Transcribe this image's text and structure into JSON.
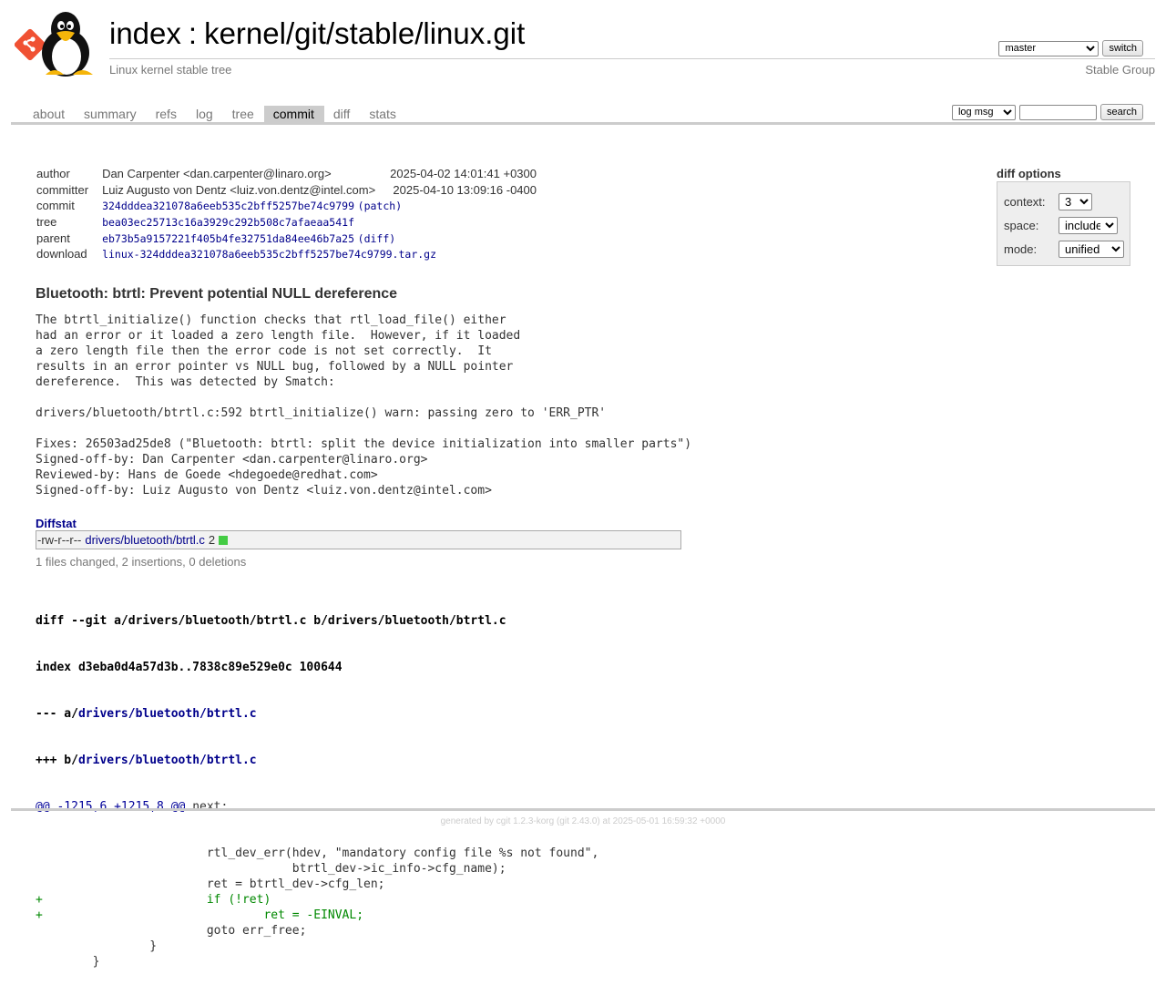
{
  "header": {
    "index_link": "index",
    "separator": ":",
    "repo_path": "kernel/git/stable/linux.git",
    "subtitle": "Linux kernel stable tree",
    "owner": "Stable Group",
    "branch_selected": "master",
    "switch_label": "switch"
  },
  "tabs": [
    {
      "label": "about"
    },
    {
      "label": "summary"
    },
    {
      "label": "refs"
    },
    {
      "label": "log"
    },
    {
      "label": "tree"
    },
    {
      "label": "commit",
      "active": true
    },
    {
      "label": "diff"
    },
    {
      "label": "stats"
    }
  ],
  "search": {
    "scope_selected": "log msg",
    "query": "",
    "button_label": "search"
  },
  "commit_info": {
    "author_label": "author",
    "author": "Dan Carpenter <dan.carpenter@linaro.org>",
    "author_date": "2025-04-02 14:01:41 +0300",
    "committer_label": "committer",
    "committer": "Luiz Augusto von Dentz <luiz.von.dentz@intel.com>",
    "committer_date": "2025-04-10 13:09:16 -0400",
    "commit_label": "commit",
    "commit_hash": "324dddea321078a6eeb535c2bff5257be74c9799",
    "patch_link": "patch",
    "tree_label": "tree",
    "tree_hash": "bea03ec25713c16a3929c292b508c7afaeaa541f",
    "parent_label": "parent",
    "parent_hash": "eb73b5a9157221f405b4fe32751da84ee46b7a25",
    "diff_link": "diff",
    "download_label": "download",
    "download_file": "linux-324dddea321078a6eeb535c2bff5257be74c9799.tar.gz"
  },
  "diff_options": {
    "title": "diff options",
    "context_label": "context:",
    "context_value": "3",
    "space_label": "space:",
    "space_value": "include",
    "mode_label": "mode:",
    "mode_value": "unified"
  },
  "subject": "Bluetooth: btrtl: Prevent potential NULL dereference",
  "message": "The btrtl_initialize() function checks that rtl_load_file() either\nhad an error or it loaded a zero length file.  However, if it loaded\na zero length file then the error code is not set correctly.  It\nresults in an error pointer vs NULL bug, followed by a NULL pointer\ndereference.  This was detected by Smatch:\n\ndrivers/bluetooth/btrtl.c:592 btrtl_initialize() warn: passing zero to 'ERR_PTR'\n\nFixes: 26503ad25de8 (\"Bluetooth: btrtl: split the device initialization into smaller parts\")\nSigned-off-by: Dan Carpenter <dan.carpenter@linaro.org>\nReviewed-by: Hans de Goede <hdegoede@redhat.com>\nSigned-off-by: Luiz Augusto von Dentz <luiz.von.dentz@intel.com>",
  "diffstat": {
    "header": "Diffstat",
    "mode": "-rw-r--r--",
    "file": "drivers/bluetooth/btrtl.c",
    "count": "2",
    "summary": "1 files changed, 2 insertions, 0 deletions"
  },
  "diff": {
    "git_line_prefix": "diff --git a/drivers/bluetooth/btrtl.c b/drivers/bluetooth/btrtl.c",
    "index_line": "index d3eba0d4a57d3b..7838c89e529e0c 100644",
    "minus_prefix": "--- a/",
    "minus_file": "drivers/bluetooth/btrtl.c",
    "plus_prefix": "+++ b/",
    "plus_file": "drivers/bluetooth/btrtl.c",
    "hunk_header": "@@ -1215,6 +1215,8 @@",
    "hunk_context": " next:",
    "lines": [
      {
        "type": "ctx",
        "text": " \t\t\trtl_dev_err(hdev, \"mandatory config file %s not found\","
      },
      {
        "type": "ctx",
        "text": " \t\t\t\t    btrtl_dev->ic_info->cfg_name);"
      },
      {
        "type": "ctx",
        "text": " \t\t\tret = btrtl_dev->cfg_len;"
      },
      {
        "type": "add",
        "text": "+\t\t\tif (!ret)"
      },
      {
        "type": "add",
        "text": "+\t\t\t\tret = -EINVAL;"
      },
      {
        "type": "ctx",
        "text": " \t\t\tgoto err_free;"
      },
      {
        "type": "ctx",
        "text": " \t\t}"
      },
      {
        "type": "ctx",
        "text": " \t}"
      }
    ]
  },
  "footer": {
    "prefix": "generated by ",
    "cgit_link": "cgit 1.2.3-korg",
    "middle": " (git 2.43.0) at 2025-05-01 16:59:32 +0000"
  },
  "colors": {
    "link": "#00008b",
    "added": "#008800",
    "diffstat_bar": "#44cc44",
    "active_tab_bg": "#cccccc"
  }
}
